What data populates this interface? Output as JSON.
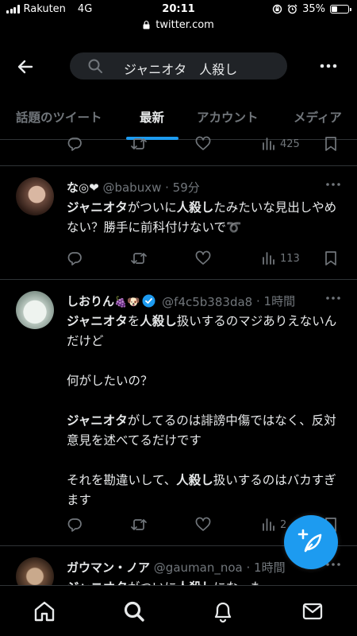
{
  "status_bar": {
    "carrier": "Rakuten",
    "network": "4G",
    "time": "20:11",
    "battery": "35%",
    "battery_level": 0.35
  },
  "url_bar": {
    "domain": "twitter.com"
  },
  "header": {
    "search_query": "ジャニオタ　人殺し"
  },
  "tabs": [
    {
      "label": "話題のツイート",
      "active": false
    },
    {
      "label": "最新",
      "active": true
    },
    {
      "label": "アカウント",
      "active": false
    },
    {
      "label": "メディア",
      "active": false
    }
  ],
  "tweets": [
    {
      "views": "425"
    },
    {
      "name": "な◎❤",
      "handle": "@babuxw",
      "time": "59分",
      "views": "113",
      "text_parts": [
        {
          "t": "ジャニオタ",
          "b": true
        },
        {
          "t": "がついに",
          "b": false
        },
        {
          "t": "人殺し",
          "b": true
        },
        {
          "t": "たみたいな見出し",
          "b": false
        },
        {
          "t": "やめない？勝手に前科付けないで➰",
          "b": false
        }
      ]
    },
    {
      "name": "しおりん",
      "badges": "🍇🐶",
      "handle": "@f4c5b383da8",
      "time": "1時間",
      "views": "2",
      "para1": [
        {
          "t": "ジャニオタ",
          "b": true
        },
        {
          "t": "を",
          "b": false
        },
        {
          "t": "人殺し",
          "b": true
        },
        {
          "t": "扱いするのマジありえないんだけど",
          "b": false
        }
      ],
      "para2": "何がしたいの？",
      "para3": [
        {
          "t": "ジャニオタ",
          "b": true
        },
        {
          "t": "がしてるのは誹謗中傷ではなく、反対意見を述べてるだけです",
          "b": false
        }
      ],
      "para4": [
        {
          "t": "それを勘違いして、",
          "b": false
        },
        {
          "t": "人殺し",
          "b": true
        },
        {
          "t": "扱いするのはバカすぎます",
          "b": false
        }
      ]
    },
    {
      "name": "ガウマン・ノア",
      "handle": "@gauman_noa",
      "time": "1時間",
      "preview": [
        {
          "t": "ジャニオタ",
          "b": true
        },
        {
          "t": "がついに",
          "b": false
        },
        {
          "t": "人殺し",
          "b": true
        },
        {
          "t": "にな…も",
          "b": false
        }
      ]
    }
  ],
  "colors": {
    "accent": "#1d9bf0",
    "background": "#000000",
    "muted": "#71767b",
    "divider": "#2f3336"
  },
  "icons": [
    "back-arrow-icon",
    "search-icon",
    "more-icon",
    "reply-icon",
    "retweet-icon",
    "like-icon",
    "views-icon",
    "bookmark-icon",
    "compose-icon",
    "home-icon",
    "explore-icon",
    "notifications-icon",
    "messages-icon"
  ]
}
